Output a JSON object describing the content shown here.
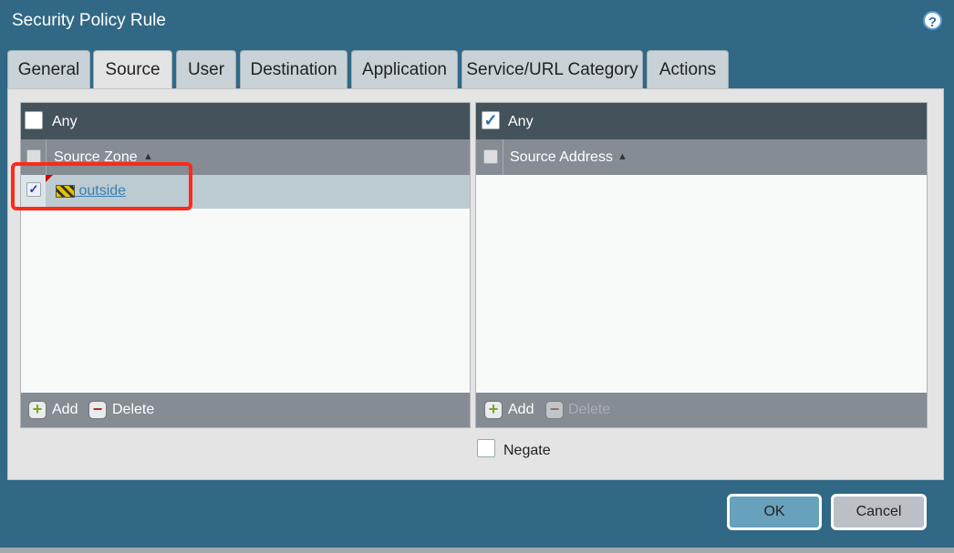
{
  "title": "Security Policy Rule",
  "help_icon": "?",
  "tabs": [
    "General",
    "Source",
    "User",
    "Destination",
    "Application",
    "Service/URL Category",
    "Actions"
  ],
  "active_tab": "Source",
  "source_zone": {
    "any_label": "Any",
    "any_checked": false,
    "column": "Source Zone",
    "rows": [
      {
        "name": " outside",
        "checked": true,
        "icon": "zone-barrier-icon"
      }
    ],
    "add": "Add",
    "delete": "Delete"
  },
  "source_address": {
    "any_label": "Any",
    "any_checked": true,
    "column": "Source Address",
    "rows": [],
    "add": "Add",
    "delete": "Delete",
    "delete_disabled": true
  },
  "negate_label": "Negate",
  "negate_checked": false,
  "ok": "OK",
  "cancel": "Cancel",
  "colors": {
    "background": "#316885",
    "highlight": "#ff2a1a",
    "link": "#3a7fb0"
  }
}
